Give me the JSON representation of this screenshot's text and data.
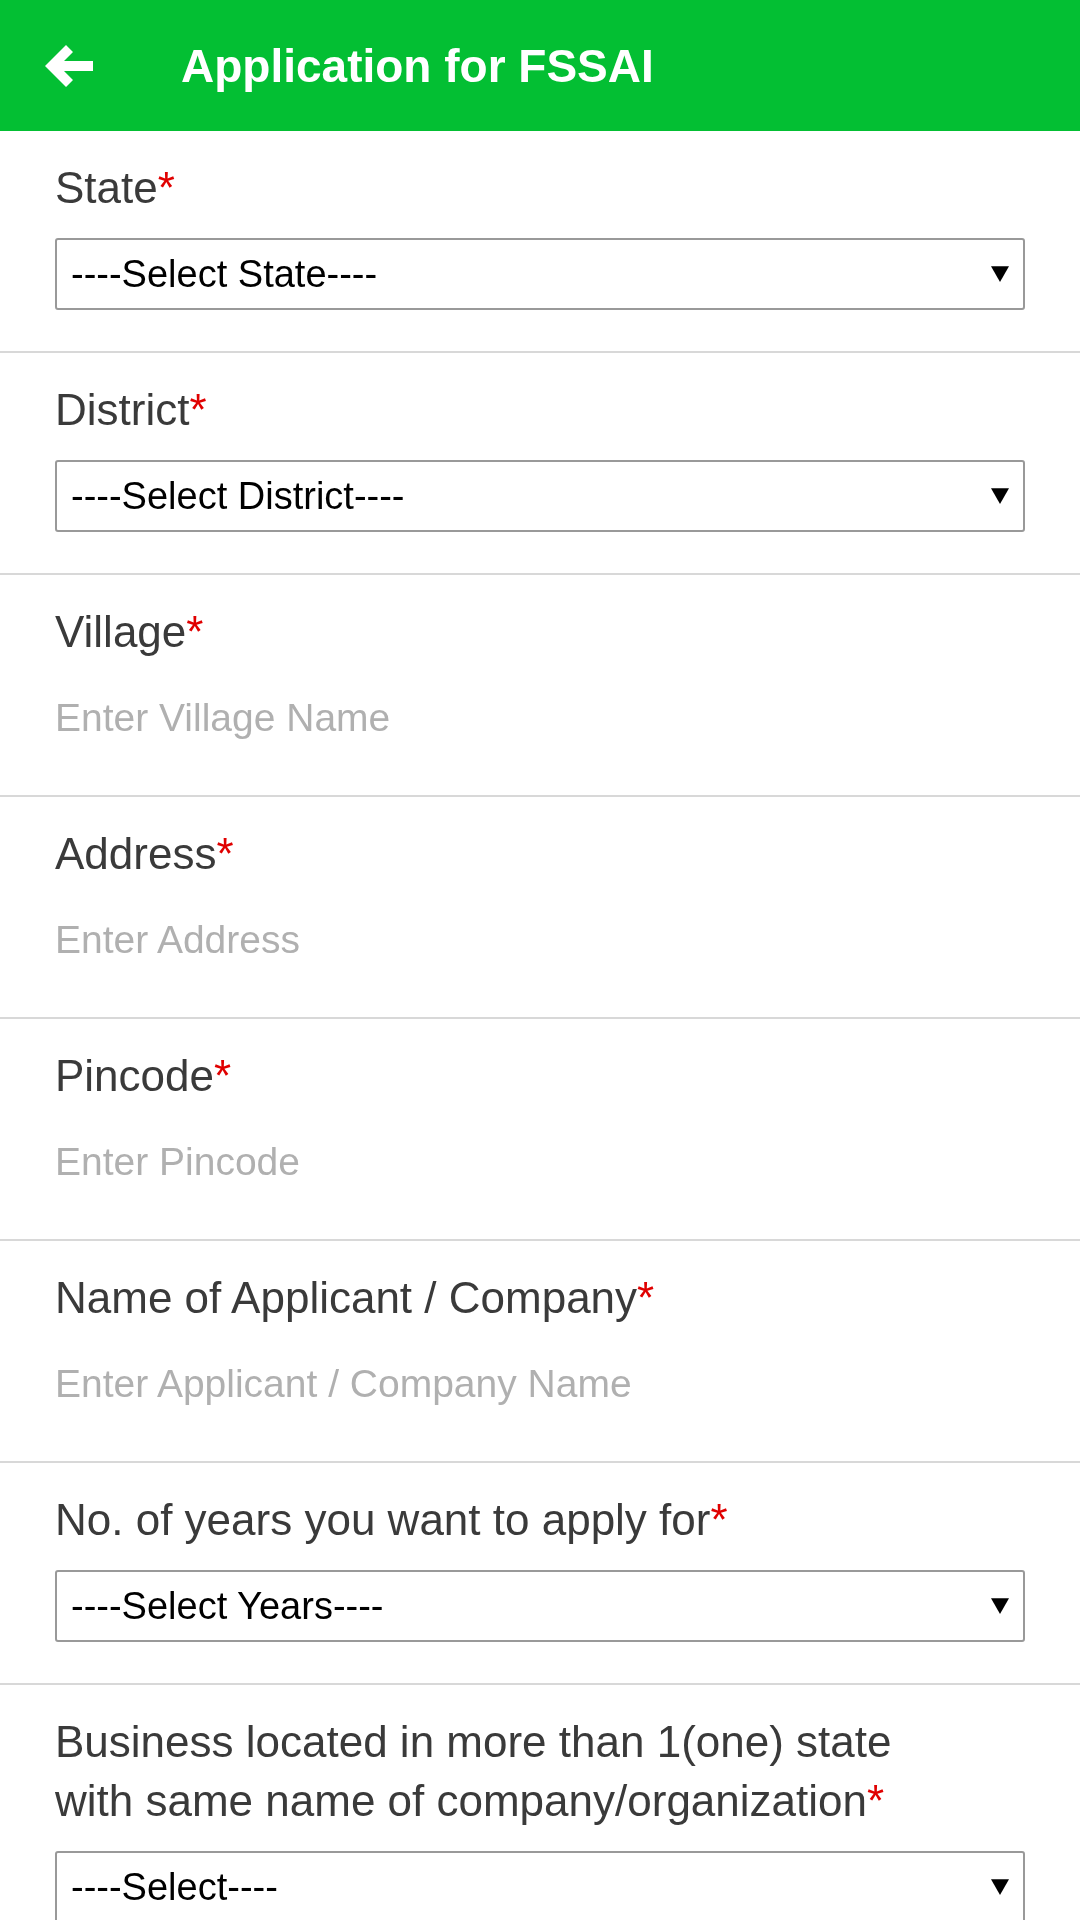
{
  "header": {
    "title": "Application for FSSAI"
  },
  "fields": [
    {
      "label": "State",
      "mark": "*",
      "kind": "select",
      "value": "----Select State----"
    },
    {
      "label": "District",
      "mark": "*",
      "kind": "select",
      "value": "----Select District----"
    },
    {
      "label": "Village",
      "mark": "*",
      "kind": "text",
      "placeholder": "Enter Village Name"
    },
    {
      "label": "Address",
      "mark": "*",
      "kind": "text",
      "placeholder": "Enter Address"
    },
    {
      "label": "Pincode",
      "mark": "*",
      "kind": "text",
      "placeholder": "Enter Pincode"
    },
    {
      "label": "Name of Applicant / Company",
      "mark": "*",
      "kind": "text",
      "placeholder": "Enter Applicant / Company Name"
    },
    {
      "label": "No. of years you want to apply for",
      "mark": "*",
      "kind": "select",
      "value": "----Select Years----"
    },
    {
      "label": "Business located in more than 1(one) state with same name of company/organization",
      "mark": "*",
      "kind": "select",
      "value": "----Select----"
    }
  ]
}
